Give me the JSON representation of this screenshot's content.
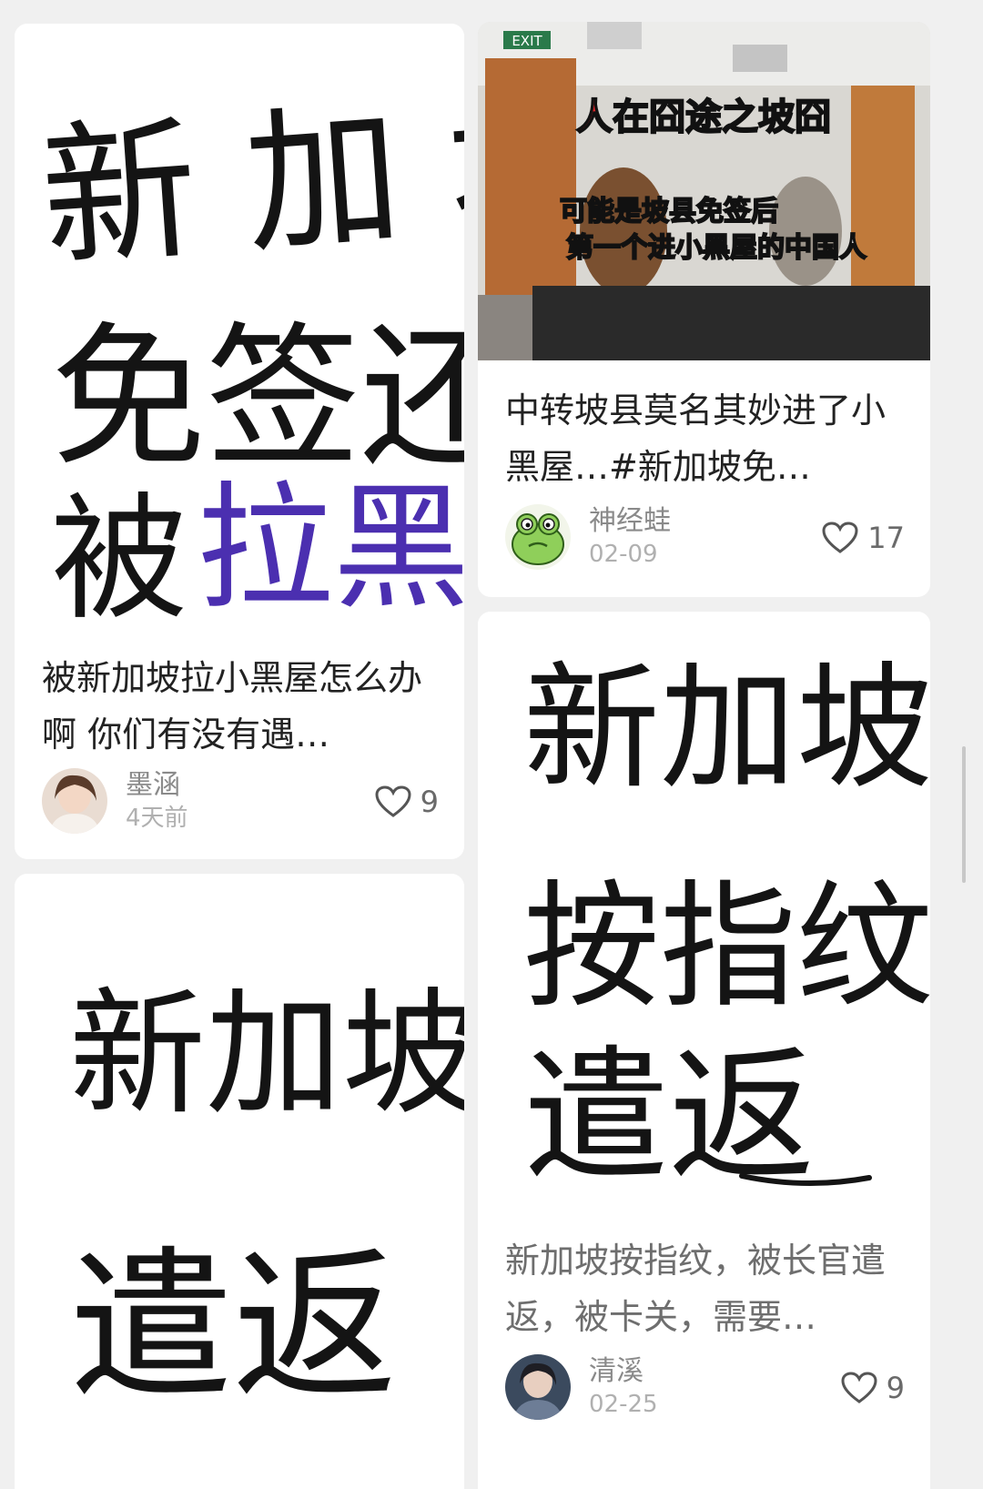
{
  "feed": {
    "cards": [
      {
        "cover_text": [
          "新 加 坡",
          "免签还",
          "被",
          "拉黑"
        ],
        "title": "被新加坡拉小黑屋怎么办啊 你们有没有遇…",
        "author": "墨涵",
        "date": "4天前",
        "likes": "9",
        "avatar_icon": "user-photo-avatar"
      },
      {
        "cover_caption_red": "人在囧途之坡囧",
        "cover_caption_line1": "可能是坡县免签后",
        "cover_caption_line2": "第一个进小黑屋的中国人",
        "cover_exit_sign": "EXIT",
        "title": "中转坡县莫名其妙进了小黑屋…#新加坡免…",
        "author": "神经蛙",
        "date": "02-09",
        "likes": "17",
        "avatar_icon": "frog-avatar"
      },
      {
        "cover_text": [
          "新加坡",
          "遣返"
        ]
      },
      {
        "cover_text": [
          "新加坡",
          "按指纹",
          "遣返"
        ],
        "title": "新加坡按指纹，被长官遣返，被卡关，需要…",
        "author": "清溪",
        "date": "02-25",
        "likes": "9",
        "avatar_icon": "user-photo-avatar"
      }
    ]
  },
  "colors": {
    "background": "#f0f0f0",
    "card": "#ffffff",
    "ink": "#141414",
    "purple_ink": "#4b2fb0",
    "caption_red": "#e0262a"
  }
}
